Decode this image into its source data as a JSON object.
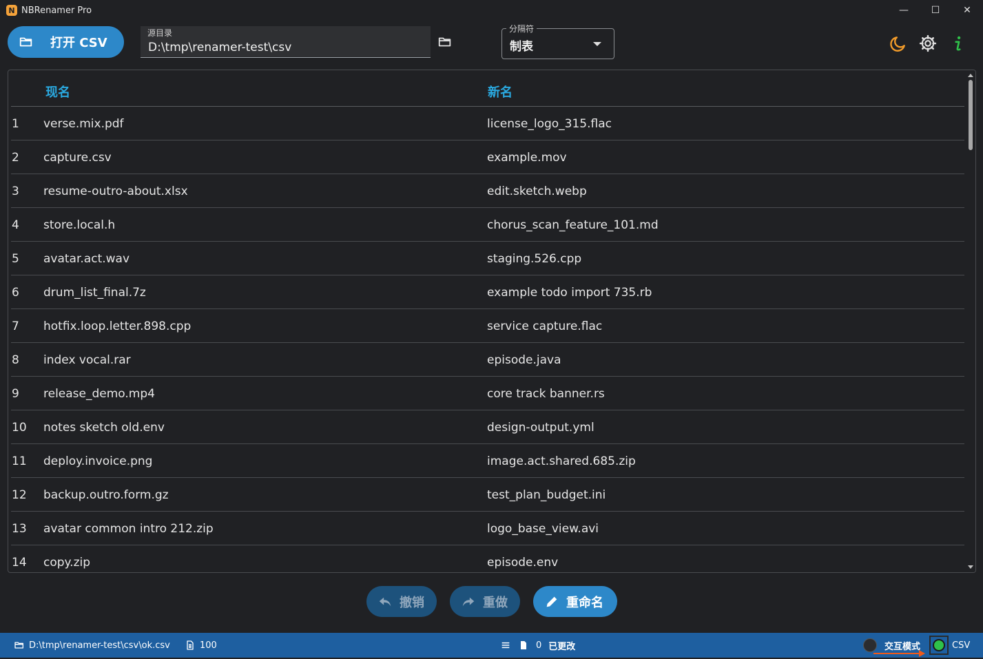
{
  "window": {
    "title": "NBRenamer Pro",
    "controls": [
      "—",
      "☐",
      "✕"
    ]
  },
  "toolbar": {
    "open_csv_label": "打开 CSV",
    "source_label": "源目录",
    "source_value": "D:\\tmp\\renamer-test\\csv",
    "separator_label": "分隔符",
    "separator_value": "制表"
  },
  "table": {
    "headers": {
      "current": "现名",
      "new": "新名"
    },
    "rows": [
      {
        "idx": "1",
        "cur": "verse.mix.pdf",
        "new": "license_logo_315.flac"
      },
      {
        "idx": "2",
        "cur": "capture.csv",
        "new": "example.mov"
      },
      {
        "idx": "3",
        "cur": "resume-outro-about.xlsx",
        "new": "edit.sketch.webp"
      },
      {
        "idx": "4",
        "cur": "store.local.h",
        "new": "chorus_scan_feature_101.md"
      },
      {
        "idx": "5",
        "cur": "avatar.act.wav",
        "new": "staging.526.cpp"
      },
      {
        "idx": "6",
        "cur": "drum_list_final.7z",
        "new": "example todo import 735.rb"
      },
      {
        "idx": "7",
        "cur": "hotfix.loop.letter.898.cpp",
        "new": "service capture.flac"
      },
      {
        "idx": "8",
        "cur": "index vocal.rar",
        "new": "episode.java"
      },
      {
        "idx": "9",
        "cur": "release_demo.mp4",
        "new": "core track banner.rs"
      },
      {
        "idx": "10",
        "cur": "notes sketch old.env",
        "new": "design-output.yml"
      },
      {
        "idx": "11",
        "cur": "deploy.invoice.png",
        "new": "image.act.shared.685.zip"
      },
      {
        "idx": "12",
        "cur": "backup.outro.form.gz",
        "new": "test_plan_budget.ini"
      },
      {
        "idx": "13",
        "cur": "avatar common intro 212.zip",
        "new": "logo_base_view.avi"
      },
      {
        "idx": "14",
        "cur": "copy.zip",
        "new": "episode.env"
      }
    ]
  },
  "actions": {
    "undo_label": "撤销",
    "redo_label": "重做",
    "rename_label": "重命名"
  },
  "statusbar": {
    "csv_path": "D:\\tmp\\renamer-test\\csv\\ok.csv",
    "file_count": "100",
    "changed_count": "0",
    "changed_label": "已更改",
    "interactive_mode_label": "交互模式",
    "mode_label": "CSV"
  },
  "colors": {
    "accent": "#2d88c9",
    "header_text": "#2aa9e0",
    "statusbar": "#1e5fa0",
    "moon_icon": "#f39c2a",
    "info_icon": "#2fc24a",
    "toggle_on": "#2fc24a"
  }
}
